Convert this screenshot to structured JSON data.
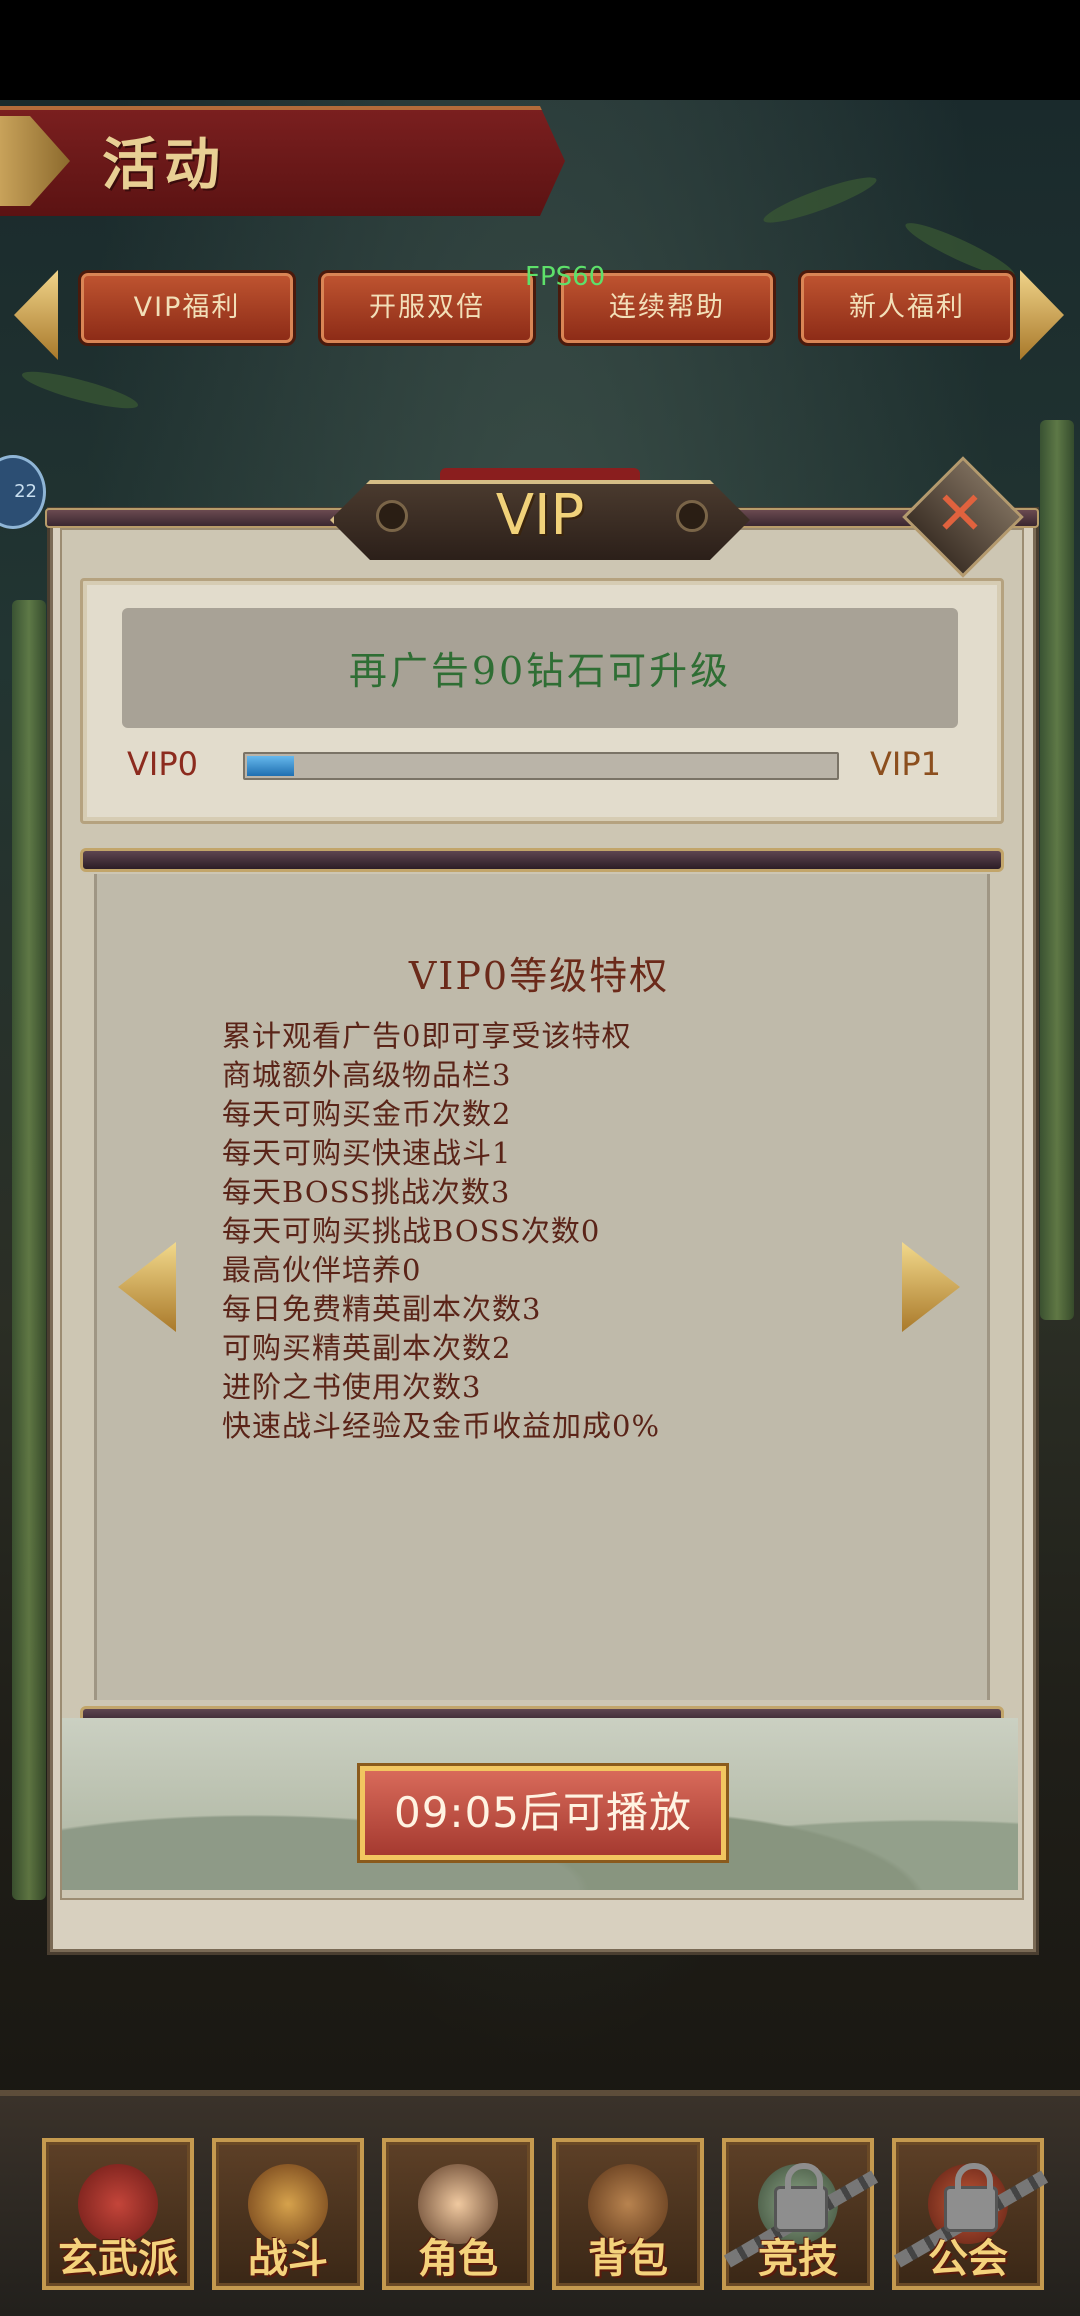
{
  "status": {
    "fps": "FPS60",
    "side_badge": "22"
  },
  "header": {
    "title": "活动"
  },
  "tabs": [
    {
      "label": "VIP福利"
    },
    {
      "label": "开服双倍"
    },
    {
      "label": "连续帮助"
    },
    {
      "label": "新人福利"
    }
  ],
  "dialog": {
    "title": "VIP",
    "message": "再广告90钻石可升级",
    "current_level": "VIP0",
    "next_level": "VIP1",
    "progress": 0.08,
    "level_title": "VIP0等级特权",
    "privileges": [
      "累计观看广告0即可享受该特权",
      "商城额外高级物品栏3",
      "每天可购买金币次数2",
      "每天可购买快速战斗1",
      "每天BOSS挑战次数3",
      "每天可购买挑战BOSS次数0",
      "最高伙伴培养0",
      "每日免费精英副本次数3",
      "可购买精英副本次数2",
      "进阶之书使用次数3",
      "快速战斗经验及金币收益加成0%"
    ],
    "play_button": "09:05后可播放"
  },
  "bottom_nav": [
    {
      "label": "玄武派",
      "icon": "sect-icon",
      "locked": false
    },
    {
      "label": "战斗",
      "icon": "battle-icon",
      "locked": false
    },
    {
      "label": "角色",
      "icon": "character-icon",
      "locked": false
    },
    {
      "label": "背包",
      "icon": "backpack-icon",
      "locked": false
    },
    {
      "label": "竞技",
      "icon": "arena-icon",
      "locked": true
    },
    {
      "label": "公会",
      "icon": "guild-icon",
      "locked": true
    }
  ],
  "colors": {
    "accent_gold": "#f1d27a",
    "message_green": "#2f6e34",
    "progress_blue": "#1f6fb0",
    "text_brown": "#5a2418"
  }
}
